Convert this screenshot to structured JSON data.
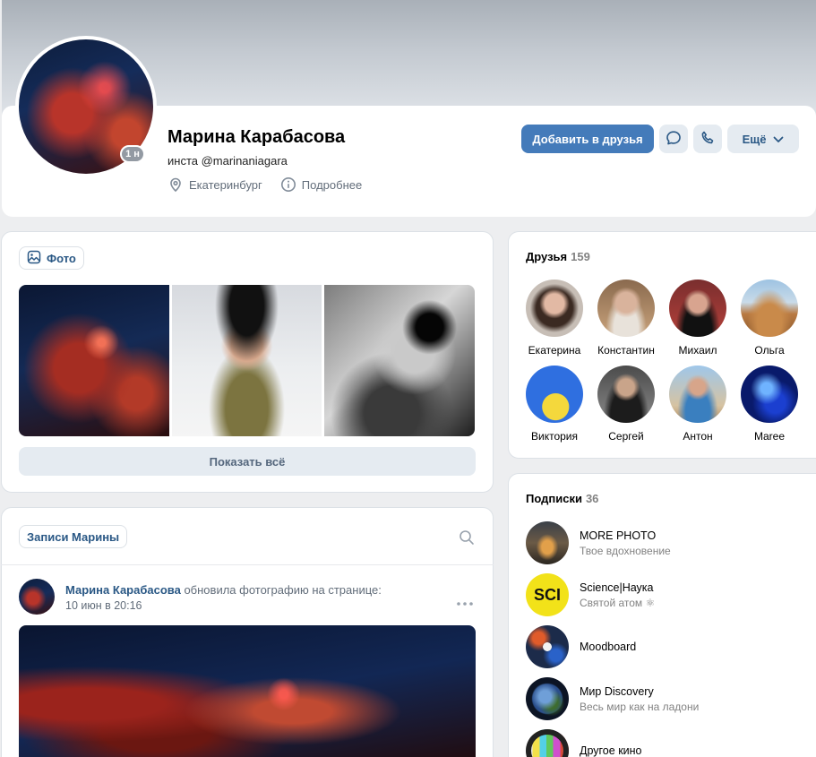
{
  "profile": {
    "name": "Марина Карабасова",
    "status": "инста @marinaniagara",
    "online_badge": "1 н",
    "city": "Екатеринбург",
    "details_link": "Подробнее",
    "add_friend_label": "Добавить в друзья",
    "more_label": "Ещё",
    "accent_color": "#447bba",
    "icons": {
      "message": "message-icon",
      "call": "phone-icon",
      "city": "location-pin-icon",
      "details": "info-icon"
    }
  },
  "photos": {
    "chip_label": "Фото",
    "show_all_label": "Показать всё"
  },
  "wall": {
    "chip_label": "Записи Марины",
    "post": {
      "author": "Марина Карабасова",
      "action": "обновила фотографию на странице:",
      "date": "10 июн в 20:16"
    }
  },
  "friends": {
    "title": "Друзья",
    "count": "159",
    "items": [
      {
        "name": "Екатерина"
      },
      {
        "name": "Константин"
      },
      {
        "name": "Михаил"
      },
      {
        "name": "Ольга"
      },
      {
        "name": "Виктория"
      },
      {
        "name": "Сергей"
      },
      {
        "name": "Антон"
      },
      {
        "name": "Maree"
      }
    ]
  },
  "subscriptions": {
    "title": "Подписки",
    "count": "36",
    "items": [
      {
        "name": "MORE PHOTO",
        "desc": "Твое вдохновение"
      },
      {
        "name": "Science|Наука",
        "desc": "Святой атом ⚛",
        "logo": "SCI"
      },
      {
        "name": "Moodboard",
        "desc": ""
      },
      {
        "name": "Мир Discovery",
        "desc": "Весь мир как на ладони"
      },
      {
        "name": "Другое кино",
        "desc": ""
      }
    ]
  }
}
